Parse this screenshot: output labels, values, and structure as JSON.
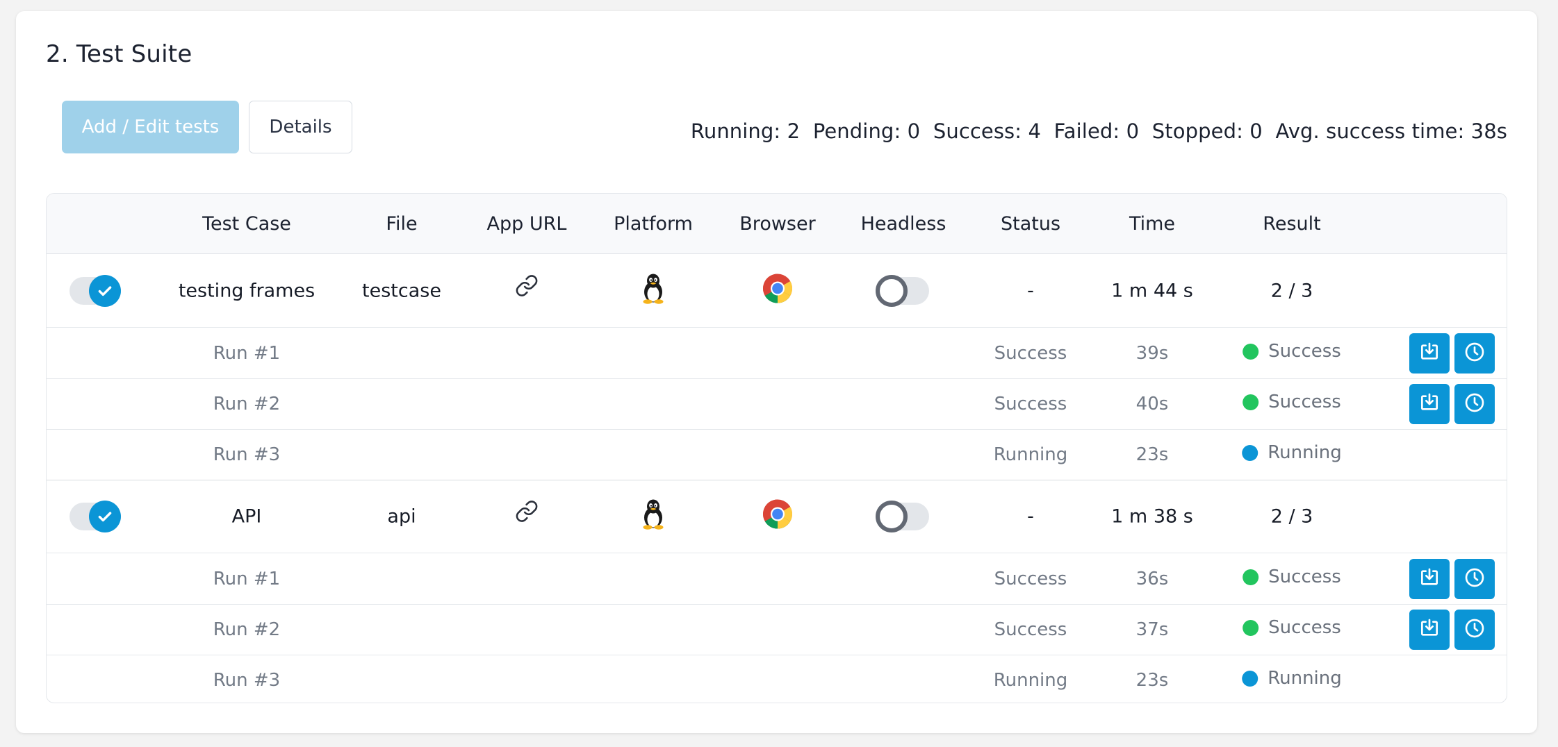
{
  "section": {
    "title": "2. Test Suite"
  },
  "toolbar": {
    "add_edit_label": "Add / Edit tests",
    "details_label": "Details"
  },
  "stats": {
    "running": "Running: 2",
    "pending": "Pending: 0",
    "success": "Success: 4",
    "failed": "Failed: 0",
    "stopped": "Stopped: 0",
    "avg": "Avg. success time: 38s"
  },
  "table": {
    "headers": {
      "test_case": "Test Case",
      "file": "File",
      "app_url": "App URL",
      "platform": "Platform",
      "browser": "Browser",
      "headless": "Headless",
      "status": "Status",
      "time": "Time",
      "result": "Result"
    },
    "tests": [
      {
        "name": "testing frames",
        "file": "testcase",
        "platform_icon": "linux-tux-icon",
        "browser_icon": "chrome-icon",
        "headless": false,
        "selected": true,
        "status": "-",
        "time": "1 m 44 s",
        "result": "2 / 3",
        "runs": [
          {
            "label": "Run #1",
            "status": "Success",
            "time": "39s",
            "result": "Success",
            "result_color": "#22c55e"
          },
          {
            "label": "Run #2",
            "status": "Success",
            "time": "40s",
            "result": "Success",
            "result_color": "#22c55e"
          },
          {
            "label": "Run #3",
            "status": "Running",
            "time": "23s",
            "result": "Running",
            "result_color": "#0b95d6"
          }
        ]
      },
      {
        "name": "API",
        "file": "api",
        "platform_icon": "linux-tux-icon",
        "browser_icon": "chrome-icon",
        "headless": false,
        "selected": true,
        "status": "-",
        "time": "1 m 38 s",
        "result": "2 / 3",
        "runs": [
          {
            "label": "Run #1",
            "status": "Success",
            "time": "36s",
            "result": "Success",
            "result_color": "#22c55e"
          },
          {
            "label": "Run #2",
            "status": "Success",
            "time": "37s",
            "result": "Success",
            "result_color": "#22c55e"
          },
          {
            "label": "Run #3",
            "status": "Running",
            "time": "23s",
            "result": "Running",
            "result_color": "#0b95d6"
          }
        ]
      }
    ]
  },
  "colors": {
    "accent": "#0b95d6",
    "accent_light": "#9fd1ea",
    "success": "#22c55e"
  }
}
